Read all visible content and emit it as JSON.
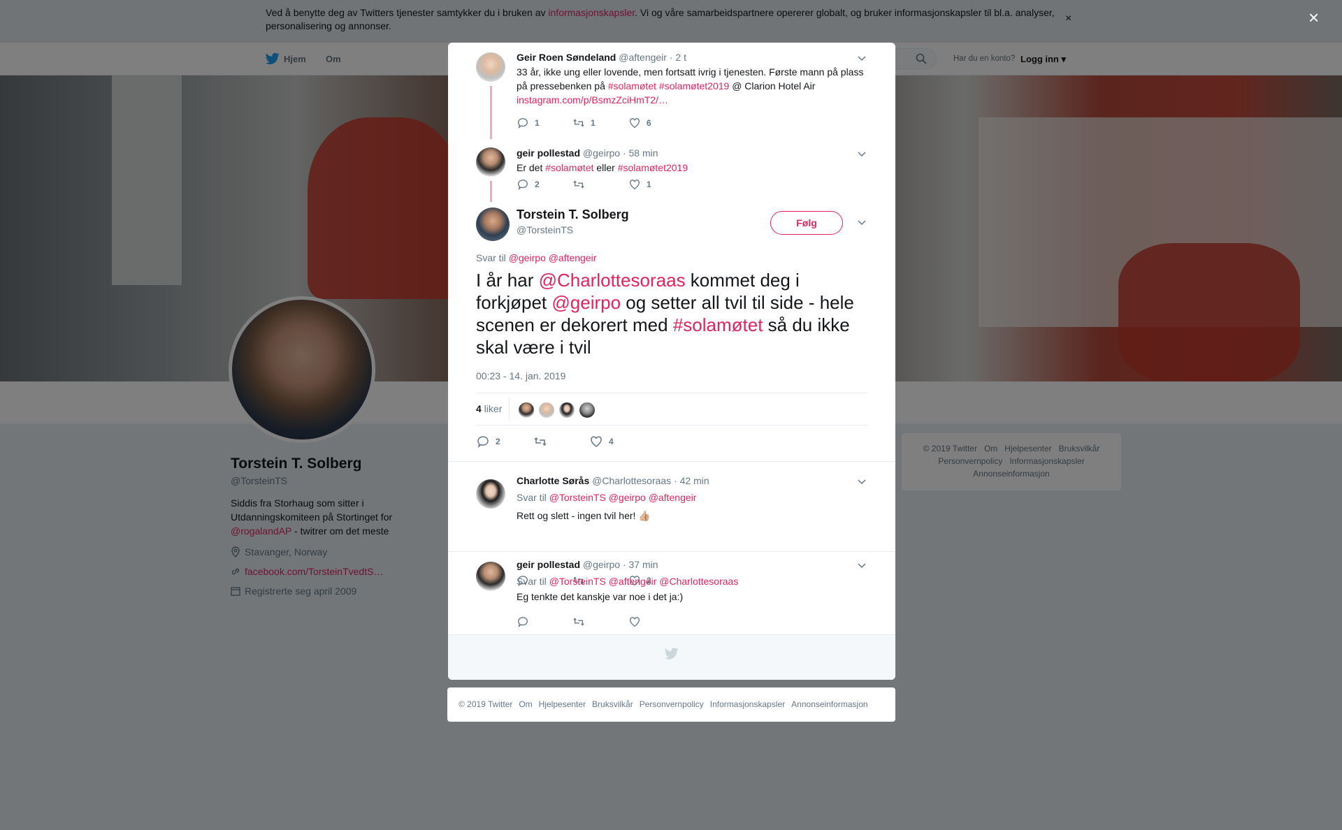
{
  "cookie": {
    "text_before": "Ved å benytte deg av Twitters tjenester samtykker du i bruken av ",
    "link": "informasjonskapsler",
    "text_after": ". Vi og våre samarbeidspartnere opererer globalt, og bruker informasjonskapsler til bl.a. analyser, personalisering og annonser.",
    "close": "×"
  },
  "nav": {
    "home": "Hjem",
    "about": "Om",
    "account_question": "Har du en konto?",
    "login": "Logg inn"
  },
  "profile": {
    "name": "Torstein T. Solberg",
    "handle": "@TorsteinTS",
    "bio_text": "Siddis fra Storhaug som sitter i Utdanningskomiteen på Stortinget for ",
    "bio_mention": "@rogalandAP",
    "bio_after": " - twitrer om det meste",
    "location": "Stavanger, Norway",
    "link": "facebook.com/TorsteinTvedtS…",
    "joined": "Registrerte seg april 2009"
  },
  "side_footer": [
    "© 2019 Twitter",
    "Om",
    "Hjelpesenter",
    "Bruksvilkår",
    "Personvernpolicy",
    "Informasjonskapsler",
    "Annonseinformasjon"
  ],
  "overlay_close": "×",
  "thread": [
    {
      "name": "Geir Roen Søndeland",
      "handle": "@aftengeir",
      "time": "· 2 t",
      "text_plain": "33 år, ikke ung eller lovende, men fortsatt ivrig i tjenesten. Første mann på plass på pressebenken på ",
      "tag1": "#solamøtet",
      "tag2": "#solamøtet2019",
      "text_after": " @ Clarion Hotel Air ",
      "link": "instagram.com/p/BsmzZciHmT2/…",
      "replies": "1",
      "retweets": "1",
      "likes": "6"
    },
    {
      "name": "geir pollestad",
      "handle": "@geirpo",
      "time": "· 58 min",
      "text_plain": "Er det ",
      "tag1": "#solamøtet",
      "text_mid": " eller ",
      "tag2": "#solamøtet2019",
      "replies": "2",
      "retweets": "",
      "likes": "1"
    }
  ],
  "main_tweet": {
    "name": "Torstein T. Solberg",
    "handle": "@TorsteinTS",
    "follow": "Følg",
    "reply_label": "Svar til ",
    "reply_to": "@geirpo @aftengeir",
    "t1": "I år har ",
    "m1": "@Charlottesoraas",
    "t2": " kommet deg i forkjøpet ",
    "m2": "@geirpo",
    "t3": " og setter all tvil til side - hele scenen er dekorert med ",
    "m3": "#solamøtet",
    "t4": " så du ikke skal være i tvil",
    "timestamp": "00:23 - 14. jan. 2019",
    "likes_count": "4",
    "likes_label": " liker",
    "replies": "2",
    "retweets": "",
    "likes": "4"
  },
  "replies": [
    {
      "name": "Charlotte Sørås",
      "handle": "@Charlottesoraas",
      "time": "· 42 min",
      "reply_label": "Svar til ",
      "reply_to": "@TorsteinTS @geirpo @aftengeir",
      "text": "Rett og slett - ingen tvil her! 👍🏼",
      "replies": "",
      "retweets": "",
      "likes": "2"
    },
    {
      "name": "geir pollestad",
      "handle": "@geirpo",
      "time": "· 37 min",
      "reply_label": "Svar til ",
      "reply_to": "@TorsteinTS @aftengeir @Charlottesoraas",
      "text": "Eg tenkte det kanskje var noe i det ja:)",
      "replies": "",
      "retweets": "",
      "likes": ""
    }
  ],
  "modal_footer": [
    "© 2019 Twitter",
    "Om",
    "Hjelpesenter",
    "Bruksvilkår",
    "Personvernpolicy",
    "Informasjonskapsler",
    "Annonseinformasjon"
  ],
  "colors": {
    "accent": "#e0245e",
    "muted": "#657786",
    "twitter_blue": "#1da1f2"
  }
}
